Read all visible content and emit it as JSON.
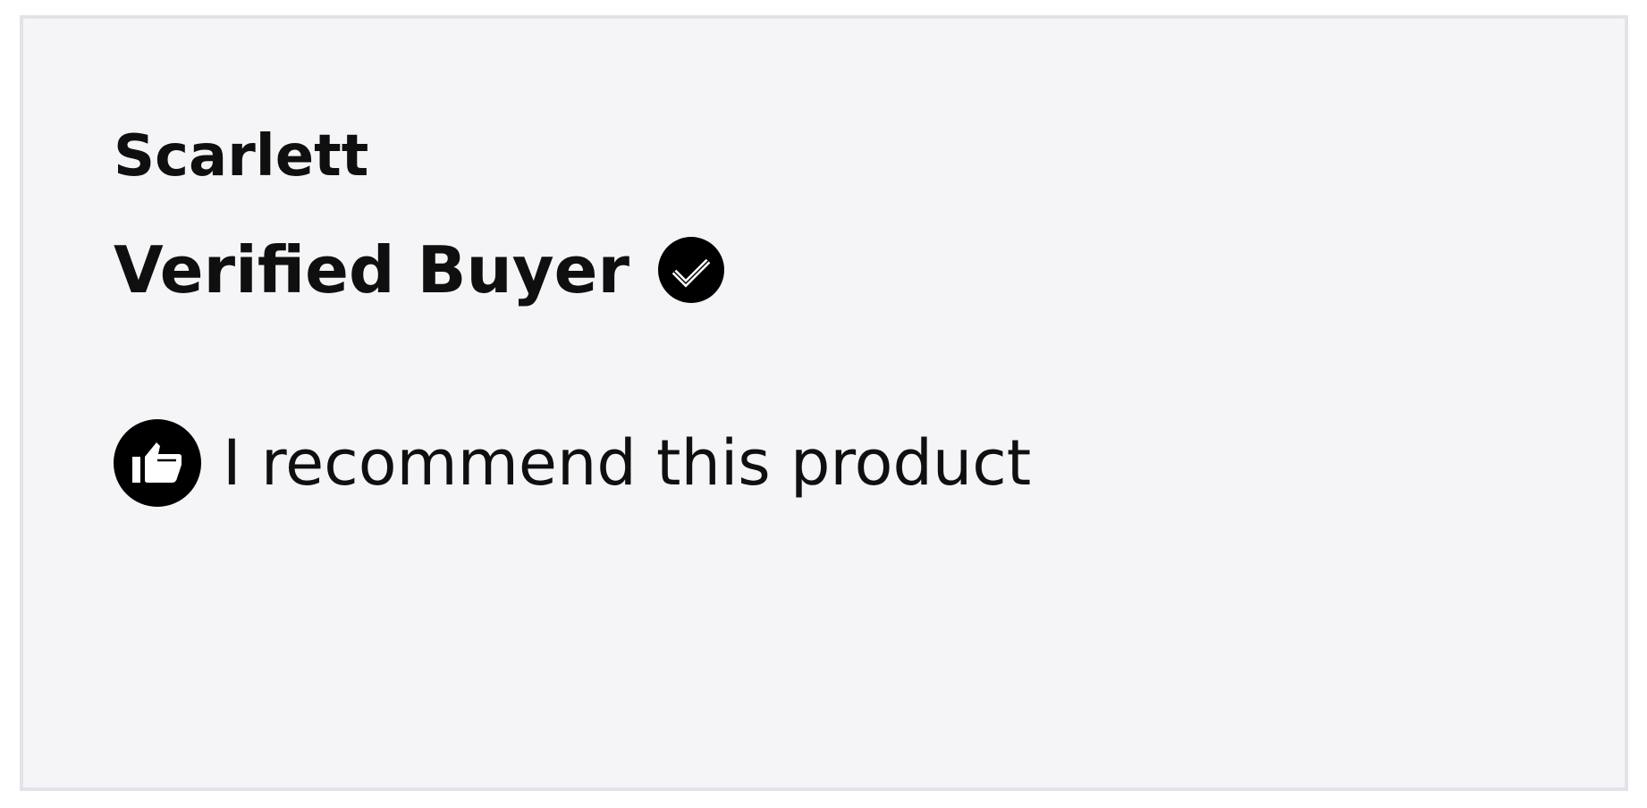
{
  "review": {
    "reviewer_name": "Scarlett",
    "verified_label": "Verified Buyer",
    "verified_icon": "check-circle-icon",
    "recommend_icon": "thumbs-up-icon",
    "recommend_text": "I recommend this product"
  },
  "colors": {
    "card_background": "#f5f5f8",
    "card_border": "#e2e3e8",
    "text": "#0f0f0f",
    "icon": "#000000"
  }
}
